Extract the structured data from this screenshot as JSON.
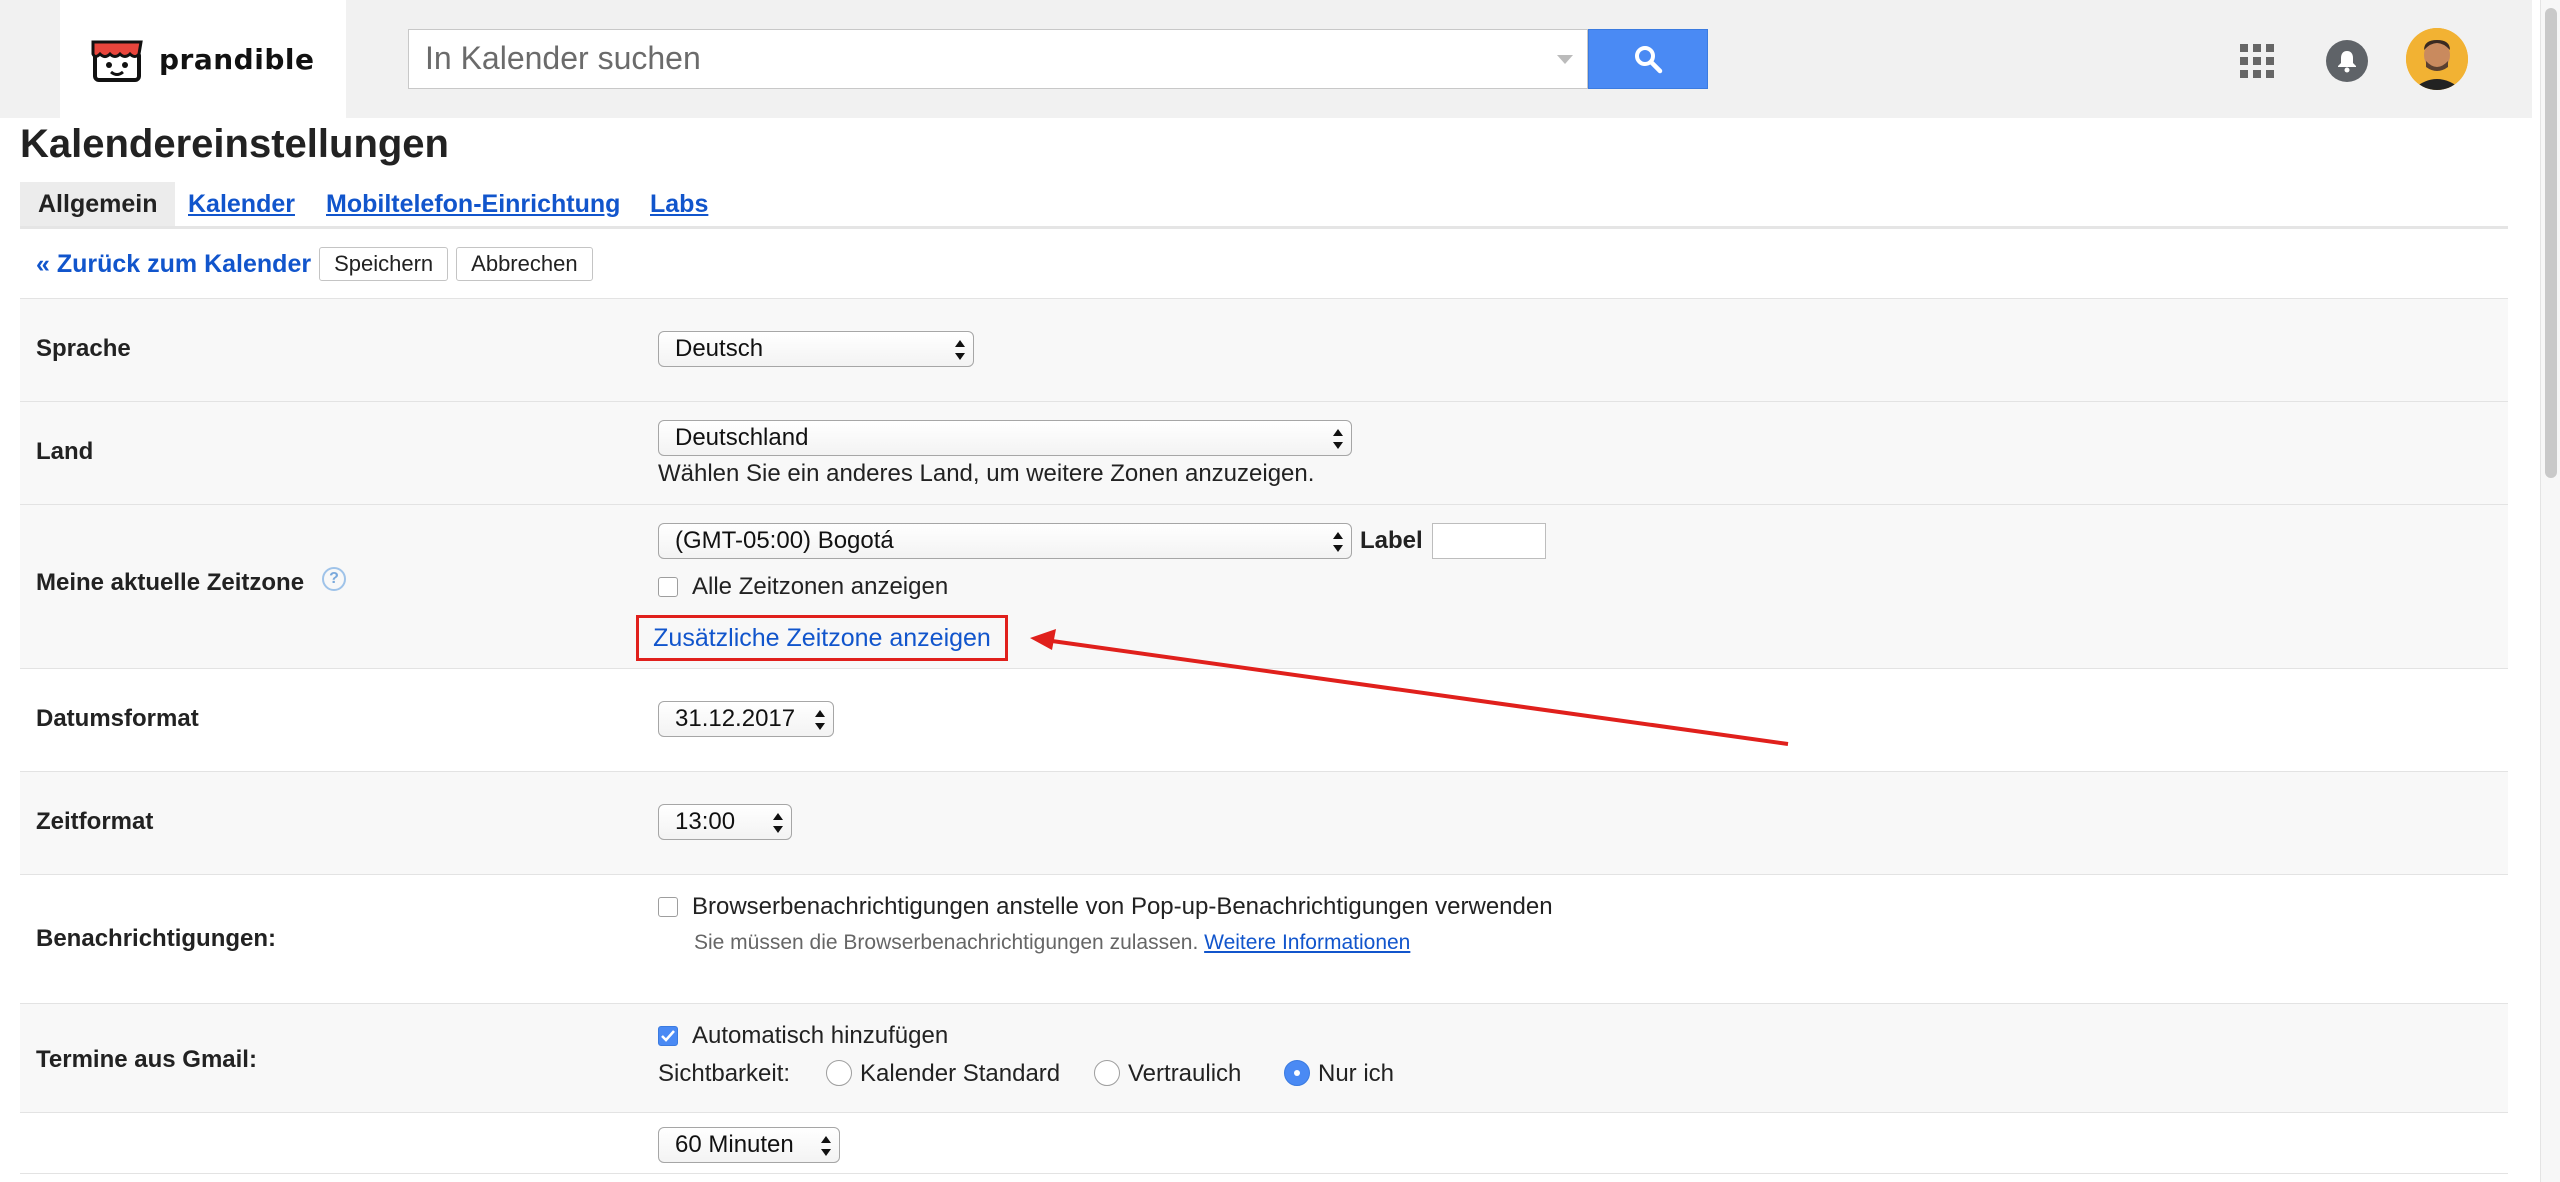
{
  "header": {
    "logo_text": "prandible",
    "search": {
      "placeholder": "In Kalender suchen",
      "value": ""
    },
    "icons": [
      "apps-grid-icon",
      "notifications-bell-icon",
      "search-icon"
    ]
  },
  "page": {
    "title": "Kalendereinstellungen",
    "tabs": [
      {
        "label": "Allgemein",
        "active": true
      },
      {
        "label": "Kalender",
        "active": false
      },
      {
        "label": "Mobiltelefon-Einrichtung",
        "active": false
      },
      {
        "label": "Labs",
        "active": false
      }
    ],
    "back_link": "« Zurück zum Kalender",
    "save_label": "Speichern",
    "cancel_label": "Abbrechen"
  },
  "settings": {
    "language": {
      "label": "Sprache",
      "value": "Deutsch"
    },
    "country": {
      "label": "Land",
      "value": "Deutschland",
      "hint": "Wählen Sie ein anderes Land, um weitere Zonen anzuzeigen."
    },
    "timezone": {
      "label": "Meine aktuelle Zeitzone",
      "help": "?",
      "value": "(GMT-05:00) Bogotá",
      "label_field": "Label",
      "label_value": "",
      "show_all_label": "Alle Zeitzonen anzeigen",
      "show_all_checked": false,
      "additional_link": "Zusätzliche Zeitzone anzeigen"
    },
    "date_format": {
      "label": "Datumsformat",
      "value": "31.12.2017"
    },
    "time_format": {
      "label": "Zeitformat",
      "value": "13:00"
    },
    "notifications": {
      "label": "Benachrichtigungen:",
      "checkbox_label": "Browserbenachrichtigungen anstelle von Pop-up-Benachrichtigungen verwenden",
      "checked": false,
      "hint": "Sie müssen die Browserbenachrichtigungen zulassen.",
      "more_info_link": "Weitere Informationen"
    },
    "gmail_events": {
      "label": "Termine aus Gmail:",
      "auto_add_label": "Automatisch hinzufügen",
      "auto_add_checked": true,
      "visibility_label": "Sichtbarkeit:",
      "visibility_options": [
        {
          "label": "Kalender Standard",
          "selected": false
        },
        {
          "label": "Vertraulich",
          "selected": false
        },
        {
          "label": "Nur ich",
          "selected": true
        }
      ]
    },
    "default_duration": {
      "value": "60 Minuten"
    }
  },
  "annotation": {
    "color": "#e0201c"
  }
}
